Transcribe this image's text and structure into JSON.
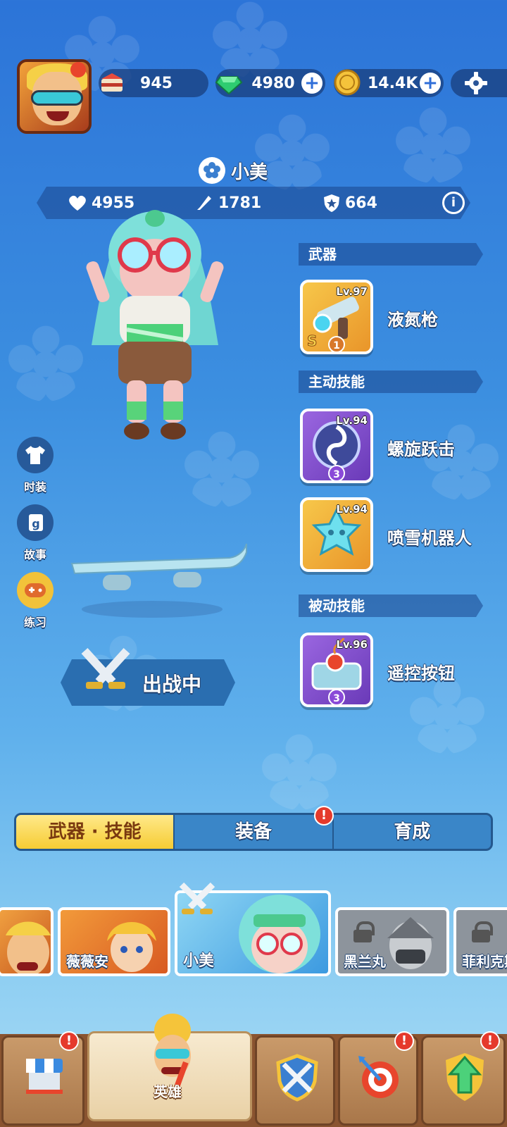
{
  "resources": {
    "cake": "945",
    "gems": "4980",
    "coins": "14.4K"
  },
  "hero": {
    "name": "小美",
    "hp": "4955",
    "attack": "1781",
    "defense": "664"
  },
  "side_menu": {
    "fashion": "时装",
    "story": "故事",
    "practice": "练习"
  },
  "sections": {
    "weapon": "武器",
    "active_skill": "主动技能",
    "passive_skill": "被动技能"
  },
  "skills": [
    {
      "name": "液氮枪",
      "level": "Lv.97",
      "rank": "1",
      "tier": "S"
    },
    {
      "name": "螺旋跃击",
      "level": "Lv.94",
      "rank": "3"
    },
    {
      "name": "喷雪机器人",
      "level": "Lv.94",
      "rank": ""
    },
    {
      "name": "遥控按钮",
      "level": "Lv.96",
      "rank": "3"
    }
  ],
  "deploy_label": "出战中",
  "tabs": [
    "武器 · 技能",
    "装备",
    "育成"
  ],
  "hero_cards": [
    "薇薇安",
    "小美",
    "黑兰丸",
    "菲利克斯"
  ],
  "bottom_nav": {
    "heroes": "英雄"
  },
  "alert_mark": "!",
  "colors": {
    "accent_gold": "#f6cc34",
    "alert_red": "#e53a2c",
    "tab_blue": "#3a86c8"
  }
}
